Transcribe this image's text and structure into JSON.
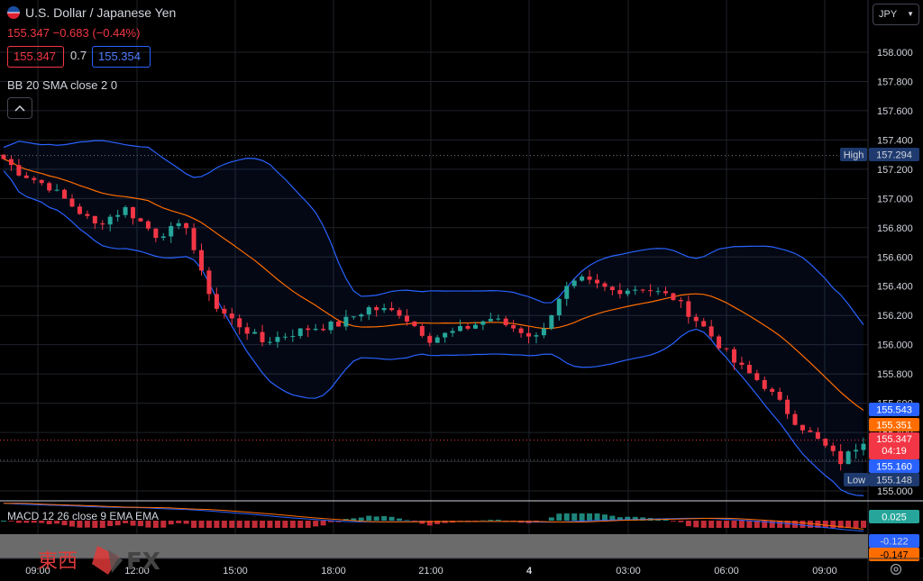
{
  "header": {
    "symbol": "U.S. Dollar / Japanese Yen",
    "change": "155.347  −0.683 (−0.44%)",
    "bid": "155.347",
    "spread": "0.7",
    "ask": "155.354",
    "indicator": "BB 20 SMA close 2 0",
    "currency": "JPY"
  },
  "macd": {
    "label": "MACD 12 26 close 9 EMA EMA"
  },
  "logo": {
    "text_kanji": "東西",
    "text_fx": "FX"
  },
  "colors": {
    "up": "#26a69a",
    "down": "#f23645",
    "bb_band": "#2962ff",
    "sma": "#ff6d00",
    "macd_line": "#2962ff",
    "signal_line": "#ff6d00"
  },
  "chart_data": [
    {
      "type": "candlestick",
      "title": "U.S. Dollar / Japanese Yen",
      "ylim": [
        154.95,
        158.25
      ],
      "y_ticks": [
        155.0,
        155.2,
        155.4,
        155.6,
        155.8,
        156.0,
        156.2,
        156.4,
        156.6,
        156.8,
        157.0,
        157.2,
        157.4,
        157.6,
        157.8,
        158.0
      ],
      "x_tick_labels": [
        "09:00",
        "12:00",
        "15:00",
        "18:00",
        "21:00",
        "4",
        "03:00",
        "06:00",
        "09:00"
      ],
      "close_anchors": {
        "x": [
          0,
          2,
          6,
          12,
          16,
          20,
          24,
          26,
          28,
          30,
          34,
          40,
          44,
          48,
          52,
          56,
          60,
          64,
          70,
          74,
          76,
          80,
          84,
          88,
          92,
          96,
          100,
          104,
          108,
          110,
          113
        ],
        "y": [
          157.27,
          157.18,
          157.08,
          156.82,
          156.93,
          156.75,
          156.82,
          156.48,
          156.25,
          156.17,
          156.02,
          156.11,
          156.14,
          156.25,
          156.22,
          156.04,
          156.1,
          156.18,
          156.05,
          156.38,
          156.44,
          156.37,
          156.39,
          156.32,
          156.12,
          155.88,
          155.72,
          155.48,
          155.3,
          155.2,
          155.35
        ]
      },
      "candle_count": 114,
      "high": "157.294",
      "low": "155.148",
      "last": "155.347",
      "countdown": "04:19",
      "bb_upper_last": "155.543",
      "sma_last": "155.351",
      "bb_lower_last": "155.160",
      "high_label": "High",
      "low_label": "Low"
    },
    {
      "type": "macd",
      "macd_last": "0.025",
      "macd_line_last": "-0.122",
      "signal_last": "-0.147"
    }
  ]
}
